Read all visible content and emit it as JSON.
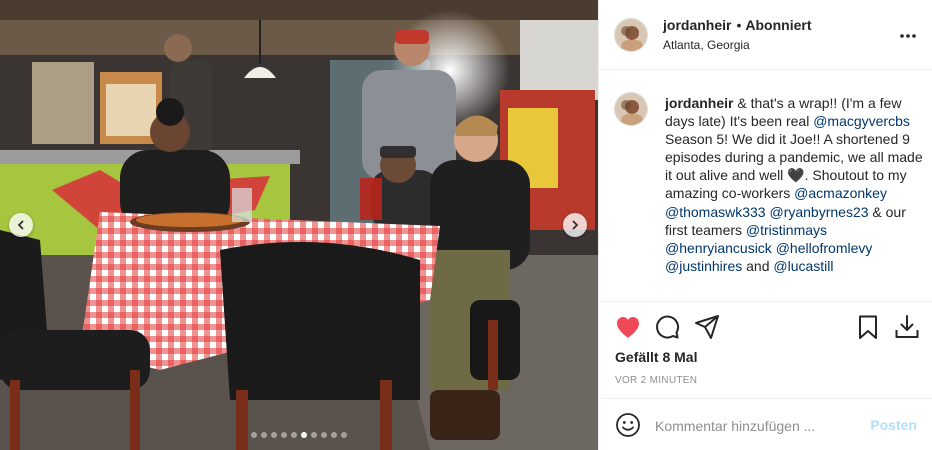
{
  "post": {
    "username": "jordanheir",
    "separator": "•",
    "follow_state": "Abonniert",
    "location": "Atlanta, Georgia",
    "caption": {
      "username": "jordanheir",
      "part1": " & that's a wrap!! (I'm a few days late) It's been real ",
      "mention1": "@macgyvercbs",
      "part2": " Season 5! We did it Joe!! A shortened 9 episodes during a pandemic, we all made it out alive and well ",
      "heart": "🖤",
      "part3": ". Shoutout to my amazing co-workers ",
      "mention2": "@acmazonkey",
      "space1": " ",
      "mention3": "@thomaswk333",
      "space2": " ",
      "mention4": "@ryanbyrnes23",
      "part4": " & our first teamers ",
      "mention5": "@tristinmays",
      "space3": " ",
      "mention6": "@henryiancusick",
      "space4": " ",
      "mention7": "@hellofromlevy",
      "space5": " ",
      "mention8": "@justinhires",
      "part5": " and ",
      "mention9": "@lucastill"
    },
    "likes_text": "Gefällt 8 Mal",
    "time_text": "vor 2 Minuten",
    "liked": true
  },
  "comment": {
    "placeholder": "Kommentar hinzufügen ...",
    "post_label": "Posten"
  },
  "carousel": {
    "slide_count": 10,
    "active_index": 5
  },
  "colors": {
    "like_red": "#ed4956",
    "link_blue": "#00376b",
    "post_disabled": "#b2dffc",
    "text": "#262626",
    "secondary": "#8e8e8e"
  },
  "icons": {
    "more": "more-horizontal-icon",
    "like": "heart-filled-icon",
    "comment": "comment-bubble-icon",
    "share": "paper-plane-icon",
    "save": "bookmark-icon",
    "download": "download-icon",
    "emoji": "smiley-icon",
    "prev": "chevron-left-icon",
    "next": "chevron-right-icon"
  }
}
